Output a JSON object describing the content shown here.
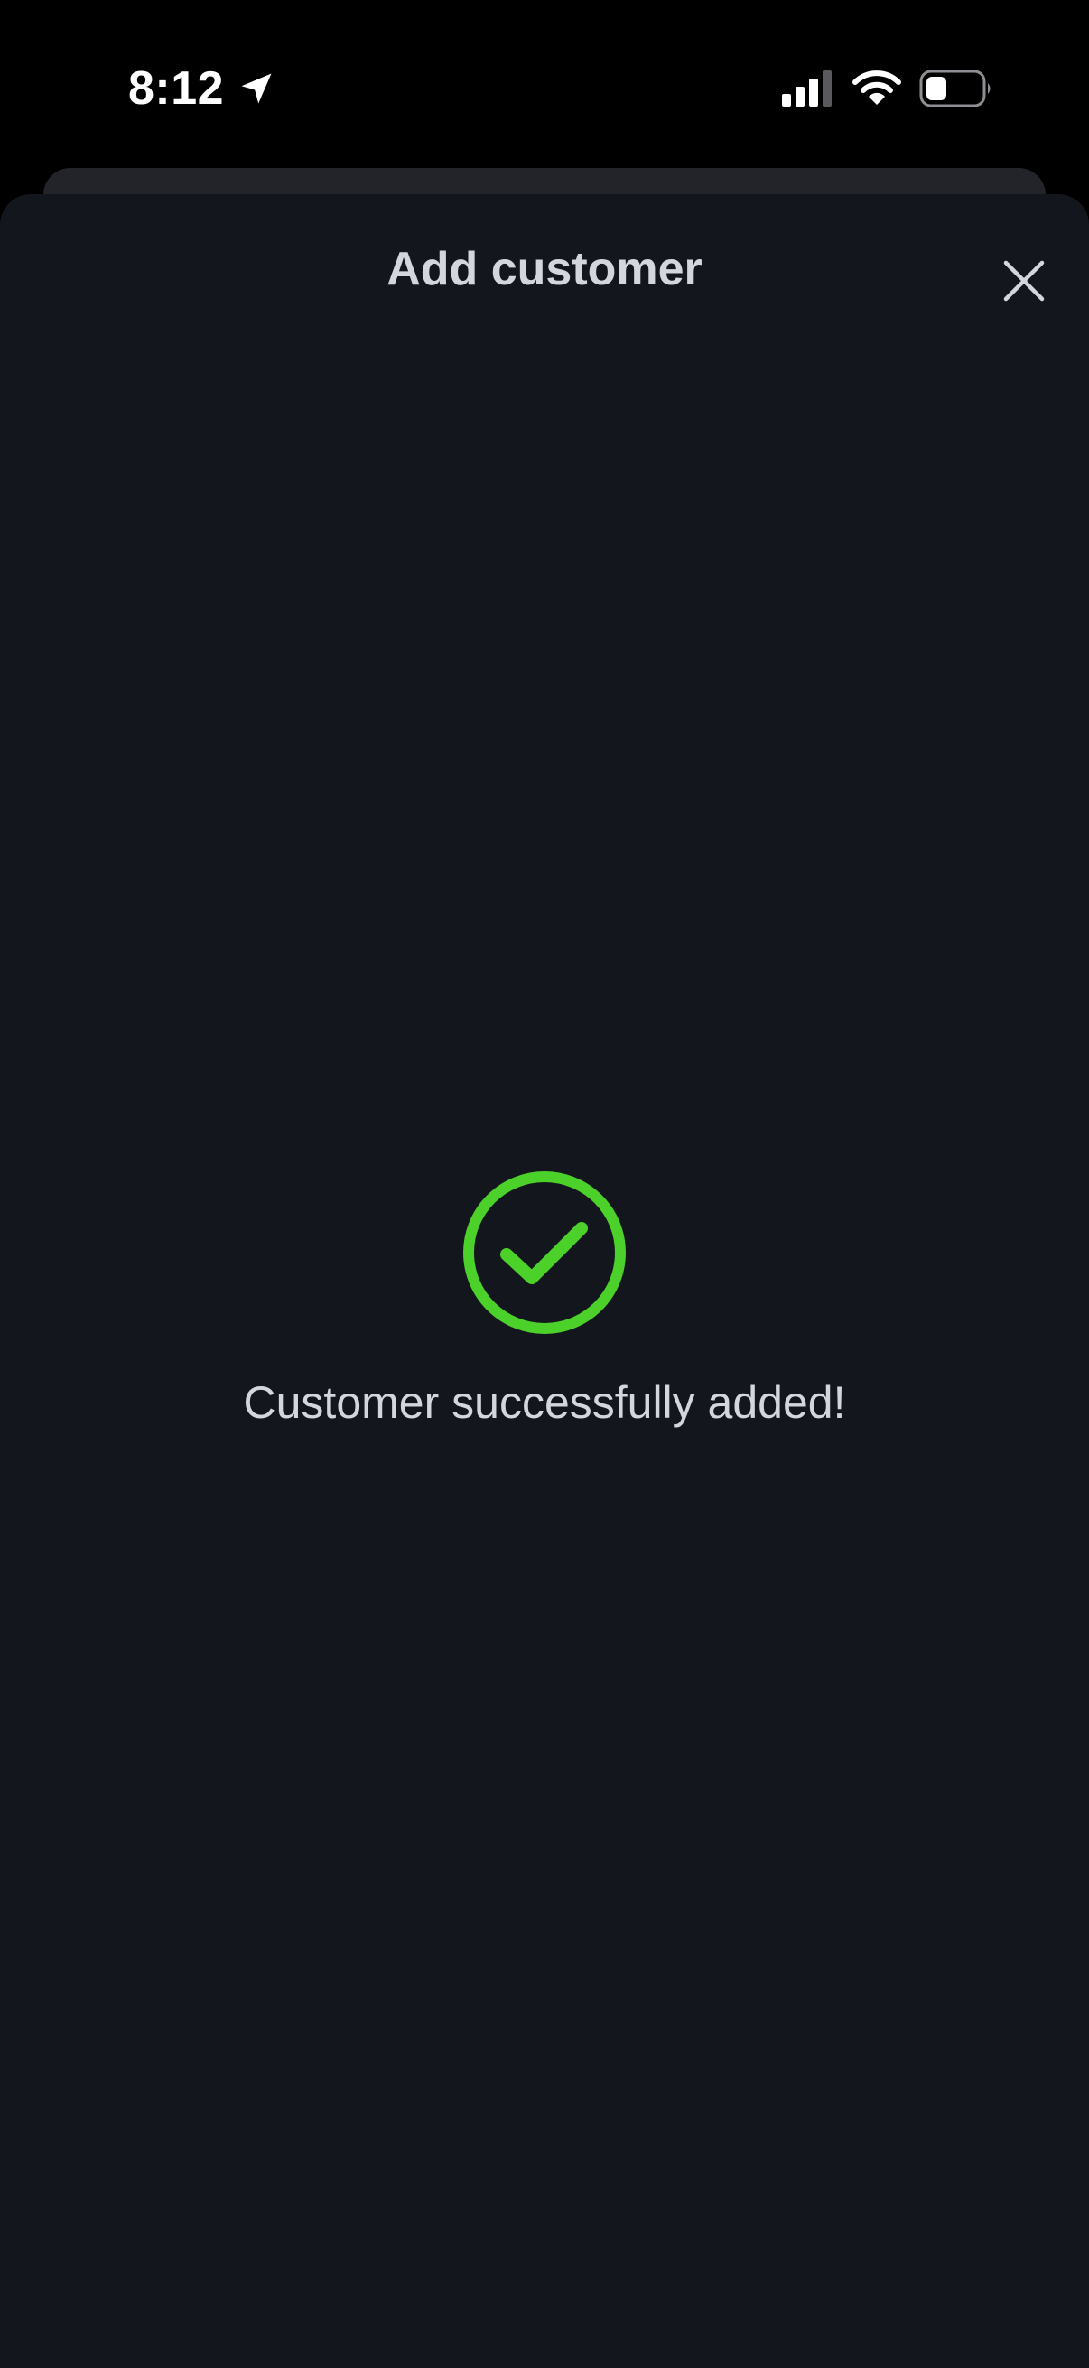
{
  "status_bar": {
    "time": "8:12",
    "icons": [
      "location-arrow-icon",
      "cellular-signal-icon",
      "wifi-icon",
      "battery-icon"
    ]
  },
  "sheet": {
    "title": "Add customer",
    "close_icon": "close-icon"
  },
  "success": {
    "icon": "check-circle-icon",
    "message": "Customer successfully added!"
  },
  "colors": {
    "background": "#000000",
    "sheet_background": "#14161e",
    "sheet_back": "#232429",
    "text_primary": "#d4d6de",
    "success_green": "#4cd12b",
    "status_white": "#ffffff"
  }
}
